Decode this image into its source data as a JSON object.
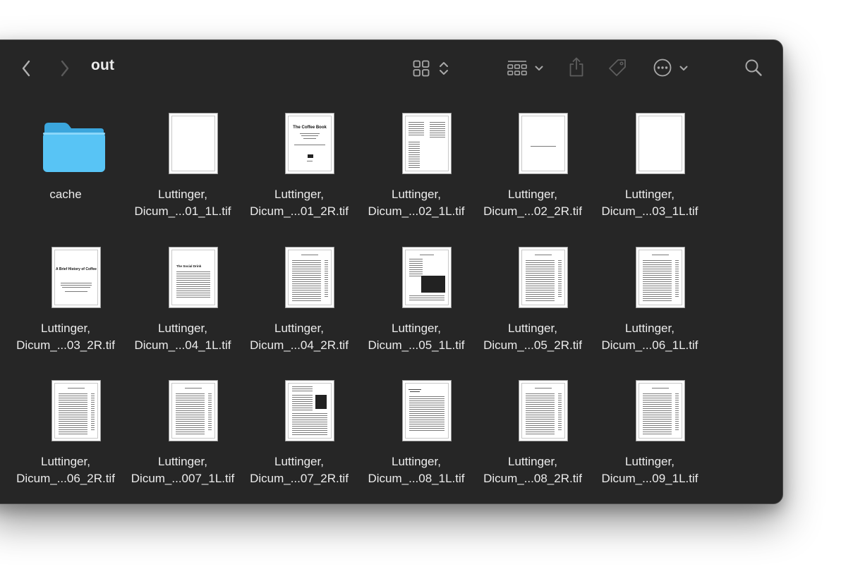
{
  "window": {
    "title": "out",
    "toolbar": {
      "back": "chevron-left-icon",
      "forward": "chevron-right-icon",
      "view": "grid-view-icon",
      "view_sort": "up-down-chevron-icon",
      "group": "group-icon",
      "group_menu": "chevron-down-icon",
      "share": "share-icon",
      "tag": "tag-icon",
      "more": "ellipsis-circle-icon",
      "more_menu": "chevron-down-icon",
      "search": "magnifying-glass-icon"
    }
  },
  "items": [
    {
      "line1": "cache",
      "line2": "",
      "kind": "folder"
    },
    {
      "line1": "Luttinger,",
      "line2": "Dicum_...01_1L.tif",
      "kind": "blank"
    },
    {
      "line1": "Luttinger,",
      "line2": "Dicum_...01_2R.tif",
      "kind": "cover",
      "cover_title": "The Coffee Book"
    },
    {
      "line1": "Luttinger,",
      "line2": "Dicum_...02_1L.tif",
      "kind": "twocol"
    },
    {
      "line1": "Luttinger,",
      "line2": "Dicum_...02_2R.tif",
      "kind": "dedication"
    },
    {
      "line1": "Luttinger,",
      "line2": "Dicum_...03_1L.tif",
      "kind": "blank"
    },
    {
      "line1": "Luttinger,",
      "line2": "Dicum_...03_2R.tif",
      "kind": "chapter",
      "chapter_title": "A Brief History of Coffee"
    },
    {
      "line1": "Luttinger,",
      "line2": "Dicum_...04_1L.tif",
      "kind": "section",
      "section_title": "The Social Drink"
    },
    {
      "line1": "Luttinger,",
      "line2": "Dicum_...04_2R.tif",
      "kind": "text"
    },
    {
      "line1": "Luttinger,",
      "line2": "Dicum_...05_1L.tif",
      "kind": "image"
    },
    {
      "line1": "Luttinger,",
      "line2": "Dicum_...05_2R.tif",
      "kind": "text"
    },
    {
      "line1": "Luttinger,",
      "line2": "Dicum_...06_1L.tif",
      "kind": "text"
    },
    {
      "line1": "Luttinger,",
      "line2": "Dicum_...06_2R.tif",
      "kind": "text"
    },
    {
      "line1": "Luttinger,",
      "line2": "Dicum_...007_1L.tif",
      "kind": "text"
    },
    {
      "line1": "Luttinger,",
      "line2": "Dicum_...07_2R.tif",
      "kind": "image2"
    },
    {
      "line1": "Luttinger,",
      "line2": "Dicum_...08_1L.tif",
      "kind": "script"
    },
    {
      "line1": "Luttinger,",
      "line2": "Dicum_...08_2R.tif",
      "kind": "text"
    },
    {
      "line1": "Luttinger,",
      "line2": "Dicum_...09_1L.tif",
      "kind": "text"
    }
  ],
  "colors": {
    "window_bg": "#262626",
    "text": "#ececec",
    "icon": "#a8a8a8",
    "folder": "#58c4f5"
  }
}
